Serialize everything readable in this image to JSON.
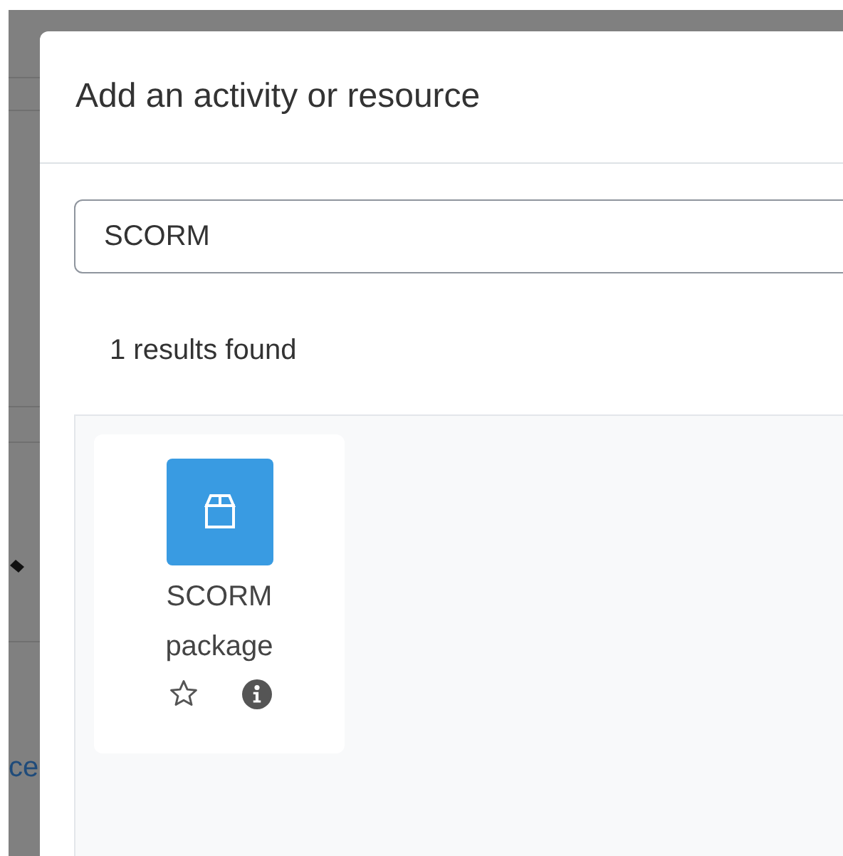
{
  "background": {
    "link_fragment": "ce"
  },
  "dialog": {
    "title": "Add an activity or resource",
    "search": {
      "value": "SCORM"
    },
    "results_count": "1 results found",
    "results": [
      {
        "name": "SCORM package",
        "starred": false
      }
    ]
  }
}
